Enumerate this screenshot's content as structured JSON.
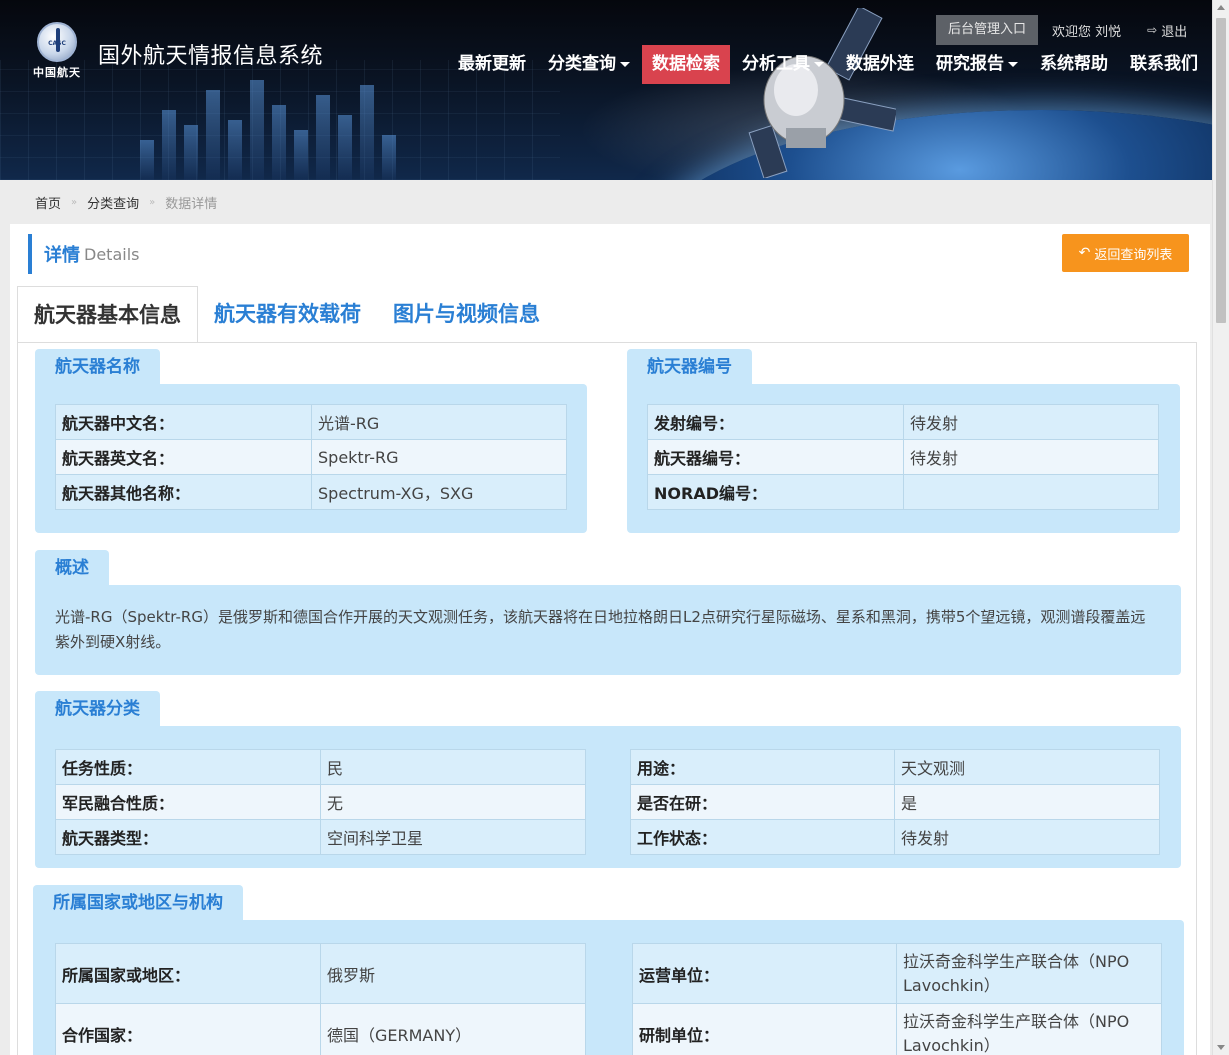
{
  "header": {
    "logo_sub": "中国航天",
    "logo_mark": "CASC",
    "site_title": "国外航天情报信息系统",
    "admin_link": "后台管理入口",
    "welcome": "欢迎您 刘悦",
    "logout": "退出",
    "nav": [
      {
        "label": "最新更新",
        "has_caret": false,
        "active": false
      },
      {
        "label": "分类查询",
        "has_caret": true,
        "active": false
      },
      {
        "label": "数据检索",
        "has_caret": false,
        "active": true
      },
      {
        "label": "分析工具",
        "has_caret": true,
        "active": false
      },
      {
        "label": "数据外连",
        "has_caret": false,
        "active": false
      },
      {
        "label": "研究报告",
        "has_caret": true,
        "active": false
      },
      {
        "label": "系统帮助",
        "has_caret": false,
        "active": false
      },
      {
        "label": "联系我们",
        "has_caret": false,
        "active": false
      }
    ],
    "accent_color": "#d9434e"
  },
  "breadcrumb": {
    "home": "首页",
    "category": "分类查询",
    "current": "数据详情",
    "separator": "»"
  },
  "panel": {
    "title_cn": "详情",
    "title_en": "Details",
    "back_button": "返回查询列表",
    "back_button_color": "#f7941d"
  },
  "tabs": [
    {
      "label": "航天器基本信息",
      "active": true
    },
    {
      "label": "航天器有效载荷",
      "active": false
    },
    {
      "label": "图片与视频信息",
      "active": false
    }
  ],
  "sections": {
    "name": {
      "title": "航天器名称",
      "rows": [
        {
          "key": "航天器中文名：",
          "value": "光谱-RG"
        },
        {
          "key": "航天器英文名：",
          "value": "Spektr-RG"
        },
        {
          "key": "航天器其他名称：",
          "value": "Spectrum-XG，SXG"
        }
      ]
    },
    "number": {
      "title": "航天器编号",
      "rows": [
        {
          "key": "发射编号：",
          "value": "待发射"
        },
        {
          "key": "航天器编号：",
          "value": "待发射"
        },
        {
          "key": "NORAD编号：",
          "value": ""
        }
      ]
    },
    "overview": {
      "title": "概述",
      "text": "光谱-RG（Spektr-RG）是俄罗斯和德国合作开展的天文观测任务，该航天器将在日地拉格朗日L2点研究行星际磁场、星系和黑洞，携带5个望远镜，观测谱段覆盖远紫外到硬X射线。"
    },
    "classification": {
      "title": "航天器分类",
      "left": [
        {
          "key": "任务性质：",
          "value": "民"
        },
        {
          "key": "军民融合性质：",
          "value": "无"
        },
        {
          "key": "航天器类型：",
          "value": "空间科学卫星"
        }
      ],
      "right": [
        {
          "key": "用途：",
          "value": "天文观测"
        },
        {
          "key": "是否在研：",
          "value": "是"
        },
        {
          "key": "工作状态：",
          "value": "待发射"
        }
      ]
    },
    "country": {
      "title": "所属国家或地区与机构",
      "left": [
        {
          "key": "所属国家或地区：",
          "value": "俄罗斯"
        },
        {
          "key": "合作国家：",
          "value": "德国（GERMANY）"
        }
      ],
      "right": [
        {
          "key": "运营单位：",
          "value": "拉沃奇金科学生产联合体（NPO Lavochkin）"
        },
        {
          "key": "研制单位：",
          "value": "拉沃奇金科学生产联合体（NPO Lavochkin）"
        }
      ]
    }
  },
  "colors": {
    "section_bg": "#c8e7fa",
    "link_blue": "#2a7fd4"
  }
}
